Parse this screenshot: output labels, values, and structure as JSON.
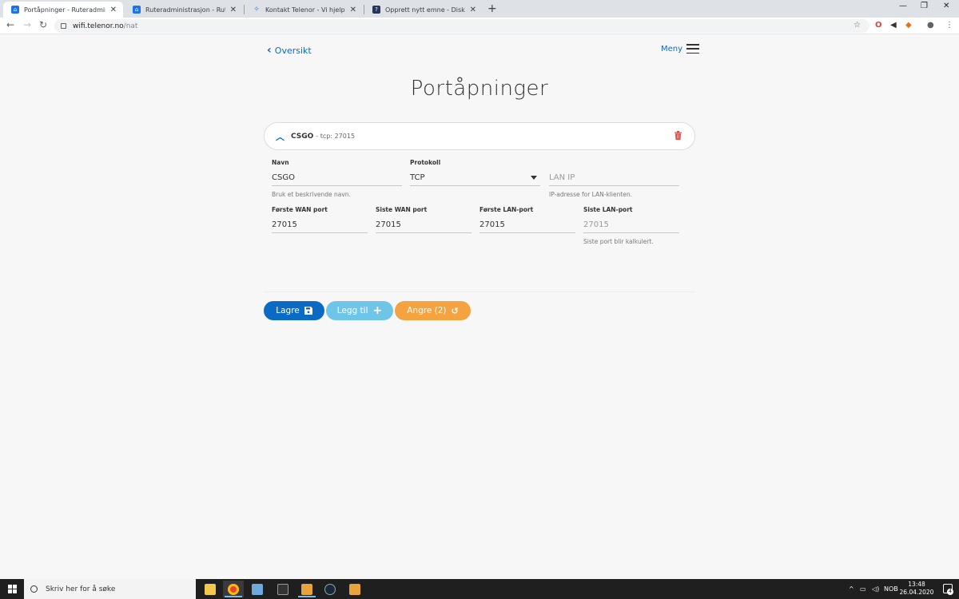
{
  "browser": {
    "tabs": [
      {
        "title": "Portåpninger - Ruteradministrasj",
        "active": true
      },
      {
        "title": "Ruteradministrasjon - Ruteradmi",
        "active": false
      },
      {
        "title": "Kontakt Telenor - Vi hjelper deg",
        "active": false
      },
      {
        "title": "Opprett nytt emne - Diskusjon.no",
        "active": false
      }
    ],
    "url_host": "wifi.telenor.no",
    "url_path": "/nat"
  },
  "page": {
    "back_label": "Oversikt",
    "menu_label": "Meny",
    "title": "Portåpninger"
  },
  "rule": {
    "name": "CSGO",
    "summary": "- tcp: 27015"
  },
  "form": {
    "navn_label": "Navn",
    "navn_value": "CSGO",
    "navn_hint": "Bruk et beskrivende navn.",
    "protokoll_label": "Protokoll",
    "protokoll_value": "TCP",
    "lanip_placeholder": "LAN IP",
    "lanip_hint": "IP-adresse for LAN-klienten.",
    "first_wan_label": "Første WAN port",
    "first_wan_value": "27015",
    "last_wan_label": "Siste WAN port",
    "last_wan_value": "27015",
    "first_lan_label": "Første LAN-port",
    "first_lan_value": "27015",
    "last_lan_label": "Siste LAN-port",
    "last_lan_value": "27015",
    "last_lan_hint": "Siste port blir kalkulert."
  },
  "actions": {
    "save_label": "Lagre",
    "add_label": "Legg til",
    "undo_label": "Angre (2)"
  },
  "taskbar": {
    "search_placeholder": "Skriv her for å søke",
    "language": "NOB",
    "time": "13:48",
    "date": "26.04.2020",
    "notifications": "4"
  },
  "colors": {
    "primary": "#0a6ac4",
    "secondary": "#6fc5e8",
    "warning": "#f4a340",
    "danger": "#e0443e"
  }
}
